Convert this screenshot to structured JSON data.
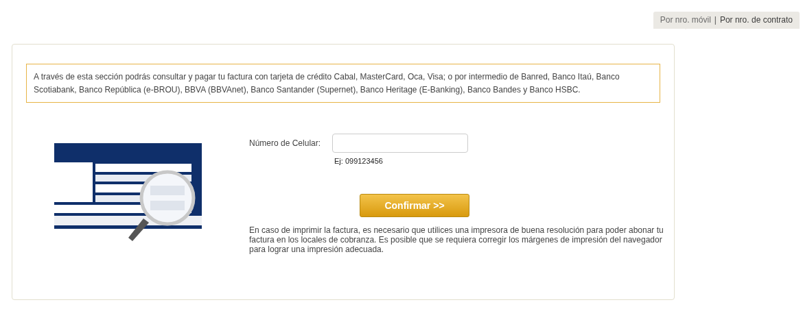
{
  "tabs": [
    {
      "label": "Por nro. móvil",
      "selected": true
    },
    {
      "label": "Por nro. de contrato",
      "selected": false
    }
  ],
  "tab_separator": "|",
  "notice": "A través de esta sección podrás consultar y pagar tu factura con tarjeta de crédito Cabal, MasterCard, Oca, Visa; o por intermedio de Banred, Banco Itaú, Banco Scotiabank, Banco República (e-BROU), BBVA (BBVAnet), Banco Santander (Supernet), Banco Heritage (E-Banking), Banco Bandes y Banco HSBC.",
  "form": {
    "label": "Número de Celular:",
    "hint": "Ej: 099123456",
    "button": "Confirmar >>"
  },
  "print_note": "En caso de imprimir la factura, es necesario que utilices una impresora de buena resolución para poder abonar tu factura en los locales de cobranza. Es posible que se requiera corregir los márgenes de impresión del navegador para lograr una impresión adecuada."
}
